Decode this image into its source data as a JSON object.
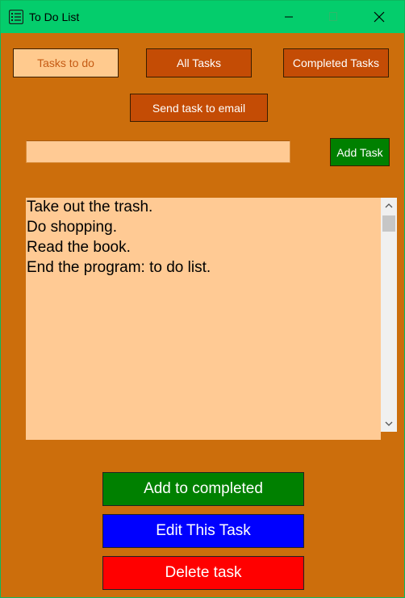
{
  "window": {
    "title": "To Do List"
  },
  "colors": {
    "background": "#cc6e0c",
    "titlebar": "#04cd6c",
    "dark_button": "#c44c05",
    "light_button": "#ffca8e",
    "list_background": "#ffca94",
    "add_task": "#008000",
    "add_completed": "#008000",
    "edit": "#0000ff",
    "delete": "#ff0000"
  },
  "toolbar": {
    "tasks_to_do_label": "Tasks to do",
    "all_tasks_label": "All Tasks",
    "completed_tasks_label": "Completed Tasks",
    "send_email_label": "Send task to email"
  },
  "entry": {
    "value": "",
    "add_task_label": "Add Task"
  },
  "tasks": [
    "Take out the trash.",
    "Do shopping.",
    "Read the book.",
    "End the program: to do list."
  ],
  "actions": {
    "add_to_completed_label": "Add to completed",
    "edit_label": "Edit This Task",
    "delete_label": "Delete task"
  },
  "icons": {
    "app": "list-icon",
    "minimize": "minimize-icon",
    "maximize": "maximize-icon",
    "close": "close-icon",
    "scroll_up": "chevron-up-icon",
    "scroll_down": "chevron-down-icon"
  }
}
